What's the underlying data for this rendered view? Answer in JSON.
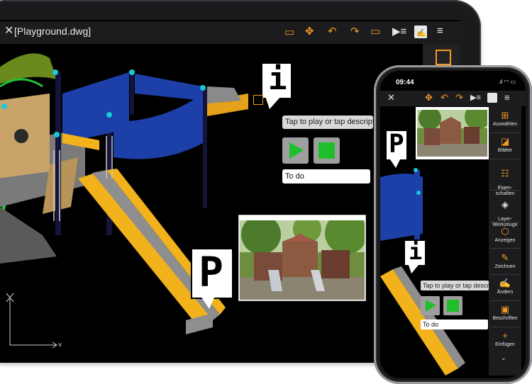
{
  "tablet": {
    "title": "[Playground.dwg]",
    "toolbar_icons": [
      "markup-icon",
      "move-icon",
      "undo-icon",
      "redo-icon",
      "comment-icon",
      "layers-play-icon",
      "edit-icon",
      "menu-icon"
    ]
  },
  "markers": {
    "info_glyph": "i",
    "parking_glyph": "P",
    "tap_text": "Tap to play or tap description",
    "todo_text": "To do"
  },
  "phone": {
    "time": "09:44",
    "sidebar": [
      {
        "label": "Auswählen",
        "icon": "select-icon"
      },
      {
        "label": "Blätter",
        "icon": "sheets-icon"
      },
      {
        "label": "Eigen-\nschaften",
        "icon": "properties-icon"
      },
      {
        "label": "Layer-\nWerkzeuge",
        "icon": "layer-tools-icon"
      },
      {
        "label": "Anzeigen",
        "icon": "view-icon"
      },
      {
        "label": "Zeichnen",
        "icon": "draw-icon"
      },
      {
        "label": "Ändern",
        "icon": "modify-icon"
      },
      {
        "label": "Beschriften",
        "icon": "annotate-icon"
      },
      {
        "label": "Einfügen",
        "icon": "insert-icon"
      }
    ],
    "tap_text": "Tap to play or tap description",
    "todo_text": "To do"
  },
  "colors": {
    "accent": "#f39a1f",
    "play_green": "#1fbf2b",
    "cad_blue": "#1d3fa8",
    "cad_yellow": "#f2b21b"
  }
}
